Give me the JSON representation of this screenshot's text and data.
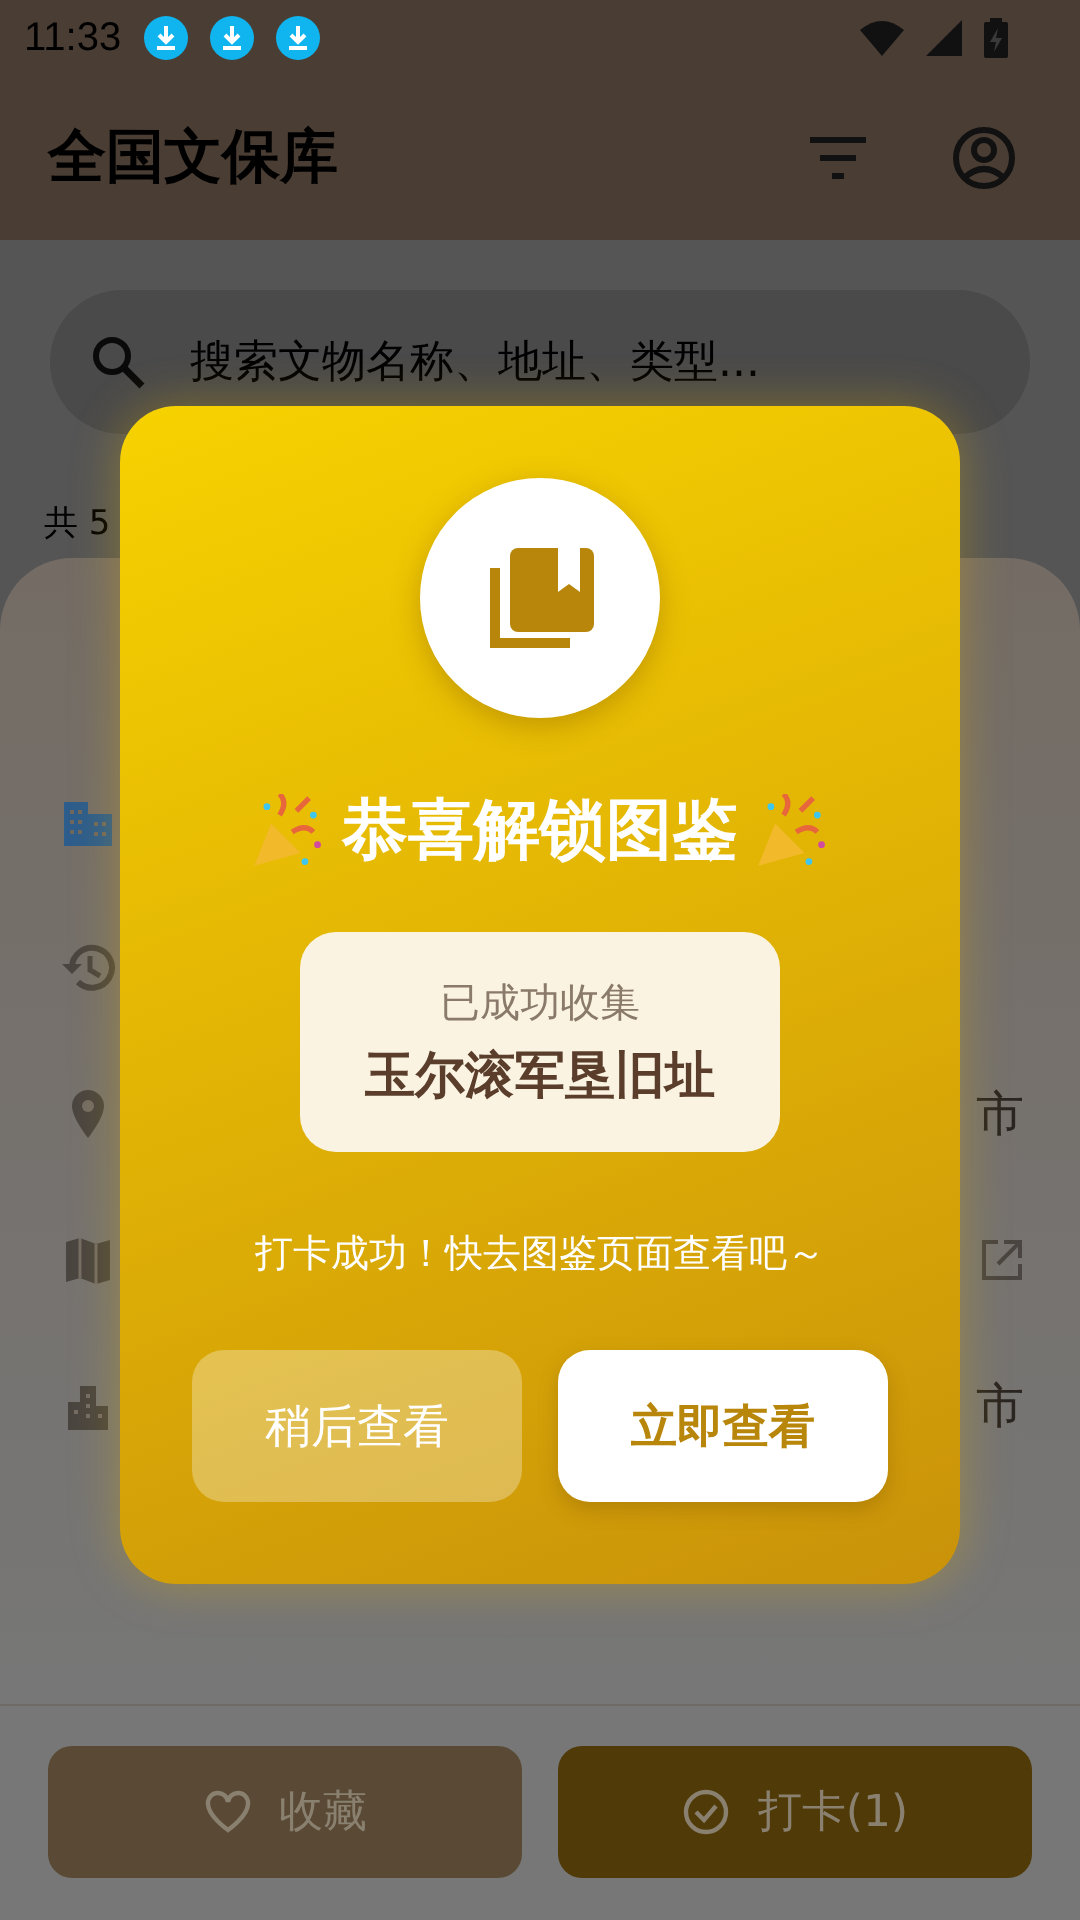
{
  "status_bar": {
    "time": "11:33",
    "notifications": [
      {
        "kind": "download"
      },
      {
        "kind": "download"
      },
      {
        "kind": "download"
      }
    ]
  },
  "app_bar": {
    "title": "全国文保库"
  },
  "search": {
    "placeholder": "搜索文物名称、地址、类型..."
  },
  "result_count": "共 5",
  "detail_sheet": {
    "rows": [
      {
        "kind": "plain"
      },
      {
        "kind": "plain"
      },
      {
        "kind": "text",
        "text": "市"
      },
      {
        "kind": "link"
      },
      {
        "kind": "text",
        "text": "市"
      }
    ]
  },
  "bottom_bar": {
    "buttons": [
      {
        "label": "收藏",
        "kind": "favorite"
      },
      {
        "label": "打卡(1)",
        "kind": "checkin"
      }
    ]
  },
  "dialog": {
    "title": "恭喜解锁图鉴",
    "collected_label": "已成功收集",
    "site_name": "玉尔滚军垦旧址",
    "message": "打卡成功！快去图鉴页面查看吧～",
    "buttons": [
      {
        "label": "稍后查看",
        "kind": "secondary"
      },
      {
        "label": "立即查看",
        "kind": "primary"
      }
    ]
  }
}
